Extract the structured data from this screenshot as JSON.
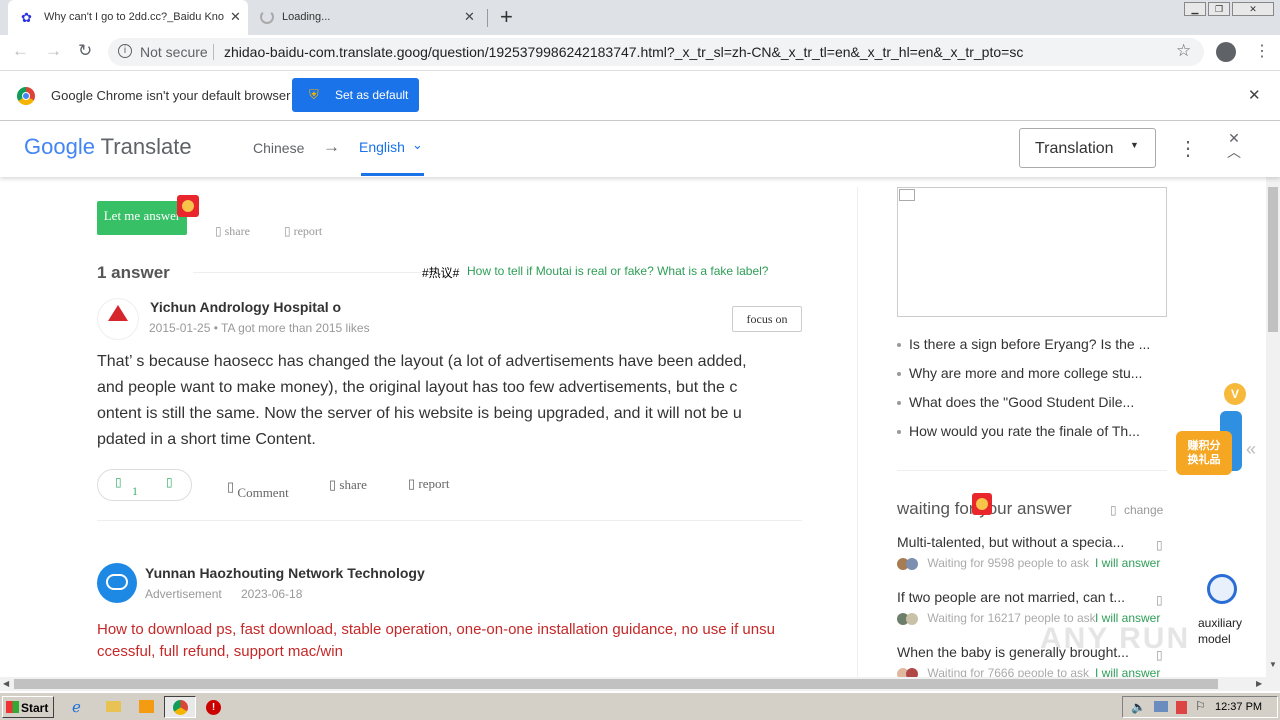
{
  "tabs": [
    {
      "title": "Why can't I go to 2dd.cc?_Baidu Kno",
      "icon": "baidu-paw-icon"
    },
    {
      "title": "Loading...",
      "icon": "loading-spinner-icon"
    }
  ],
  "new_tab_symbol": "+",
  "address_bar": {
    "security": "Not secure",
    "url": "zhidao-baidu-com.translate.goog/question/192537998624218374​7.html?_x_tr_sl=zh-CN&_x_tr_tl=en&_x_tr_hl=en&_x_tr_pto=sc"
  },
  "infobar": {
    "message": "Google Chrome isn't your default browser",
    "button": "Set as default"
  },
  "translate_bar": {
    "brand_google": "Google",
    "brand_translate": "Translate",
    "source_lang": "Chinese",
    "arrow": "→",
    "target_lang": "English",
    "mode": "Translation"
  },
  "question": {
    "answer_button": "Let me answer",
    "share": "share",
    "report": "report",
    "answer_count": "1 answer",
    "hot_tag": "#热议#",
    "hot_link": "How to tell if Moutai is real or fake? What is a fake label?"
  },
  "answer": {
    "author": "Yichun Andrology Hospital o",
    "meta": "2015-01-25 • TA got more than 2015 likes",
    "follow": "focus on",
    "lines": [
      "That’ s because haosecc has changed the layout (a lot of advertisements have been added,",
      "and people want to make money), the original layout has too few advertisements, but the c",
      "ontent is still the same. Now the server of his website is being upgraded, and it will not be u",
      "pdated in a short time Content."
    ],
    "like_count": "1",
    "comment": "Comment",
    "share": "share",
    "report": "report"
  },
  "ad": {
    "company": "Yunnan Haozhouting Network Technology",
    "label": "Advertisement",
    "date": "2023-06-18",
    "lines": [
      "How to download ps, fast download, stable operation, one-on-one installation guidance, no use if unsu",
      "ccessful, full refund, support mac/win"
    ]
  },
  "sidebar": {
    "related": [
      "Is there a sign before Eryang? Is the ...",
      "Why are more and more college stu...",
      "What does the \"Good Student Dile...",
      "How would you rate the finale of Th..."
    ],
    "waiting_title": "waiting for your answer",
    "change": "change",
    "waiting": [
      {
        "q": "Multi-talented, but without a specia...",
        "meta": "Waiting for 9598  people to ask",
        "action": "I will answer"
      },
      {
        "q": "If two people are not married, can t...",
        "meta": "Waiting for 16217  people to ask",
        "action": "I will answer"
      },
      {
        "q": "When the baby is generally brought...",
        "meta": "Waiting for 7666  people to ask",
        "action": "I will answer"
      }
    ],
    "points_badge": "赚积分换礼品",
    "auxiliary": "auxiliary model"
  },
  "taskbar": {
    "start": "Start",
    "clock": "12:37 PM"
  },
  "watermark": "ANY RUN"
}
